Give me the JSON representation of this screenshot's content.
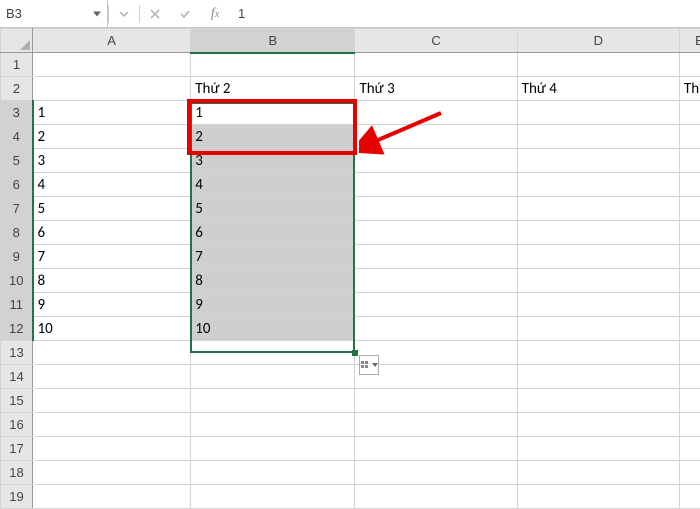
{
  "name_box": "B3",
  "formula_bar_value": "1",
  "columns": [
    "A",
    "B",
    "C",
    "D",
    "E"
  ],
  "rows": [
    1,
    2,
    3,
    4,
    5,
    6,
    7,
    8,
    9,
    10,
    11,
    12,
    13,
    14,
    15,
    16,
    17,
    18,
    19
  ],
  "cells": {
    "r2": {
      "B": "Thứ 2",
      "C": "Thứ 3",
      "D": "Thứ 4",
      "E": "Thứ"
    },
    "r3": {
      "A": "1",
      "B": "1"
    },
    "r4": {
      "A": "2",
      "B": "2"
    },
    "r5": {
      "A": "3",
      "B": "3"
    },
    "r6": {
      "A": "4",
      "B": "4"
    },
    "r7": {
      "A": "5",
      "B": "5"
    },
    "r8": {
      "A": "6",
      "B": "6"
    },
    "r9": {
      "A": "7",
      "B": "7"
    },
    "r10": {
      "A": "8",
      "B": "8"
    },
    "r11": {
      "A": "9",
      "B": "9"
    },
    "r12": {
      "A": "10",
      "B": "10"
    }
  },
  "selection": {
    "col": "B",
    "rows_from": 3,
    "rows_to": 12,
    "active_row": 3
  },
  "highlight_selected_col": "B",
  "highlight_selected_rows_from": 3,
  "highlight_selected_rows_to": 12
}
